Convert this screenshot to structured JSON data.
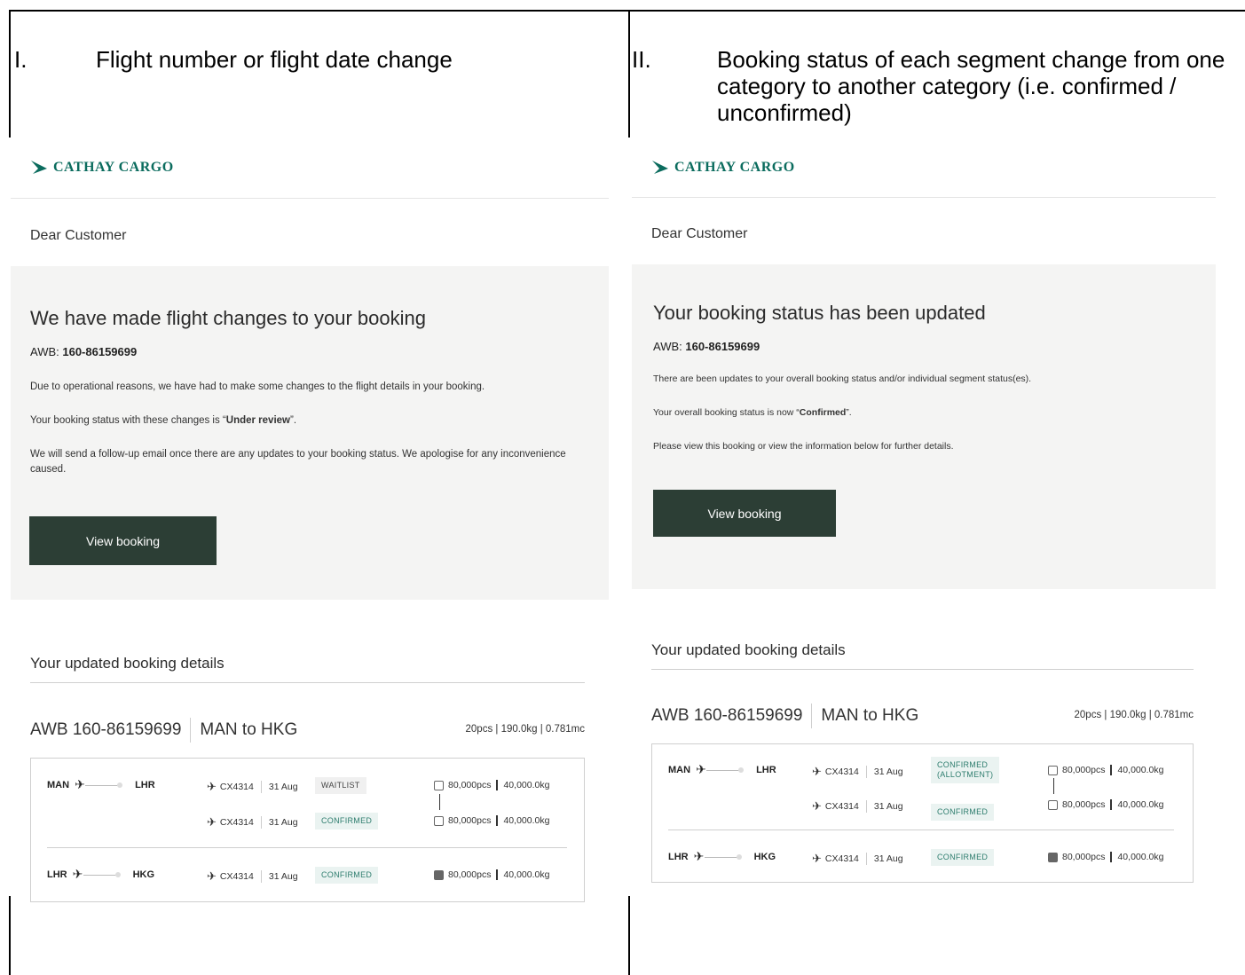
{
  "document": {
    "left_header": {
      "num": "I.",
      "text": "Flight number or flight date change"
    },
    "right_header": {
      "num": "II.",
      "text": "Booking status of each segment change from one category to another category (i.e. confirmed / unconfirmed)"
    }
  },
  "brand": {
    "name": "CATHAY CARGO",
    "color": "#0b6c5e"
  },
  "left_email": {
    "greeting": "Dear Customer",
    "title": "We have made flight changes to your booking",
    "awb_label": "AWB: ",
    "awb_value": "160-86159699",
    "p1": "Due to operational reasons, we have had to make some changes to the flight details in your booking.",
    "p2_pre": "Your booking status with these changes is “",
    "p2_bold": "Under review",
    "p2_post": "”.",
    "p3": "We will send a follow-up email once there are any updates to your booking status. We apologise for any inconvenience caused.",
    "button": "View booking",
    "section_title": "Your updated booking details",
    "awb_heading": "AWB 160-86159699",
    "route_heading": "MAN to HKG",
    "summary": "20pcs | 190.0kg | 0.781mc",
    "segments": [
      {
        "from": "MAN",
        "to": "LHR",
        "flights": [
          {
            "flight": "CX4314",
            "date": "31 Aug",
            "status": "WAITLIST",
            "pcs": "80,000pcs",
            "kg": "40,000.0kg"
          },
          {
            "flight": "CX4314",
            "date": "31 Aug",
            "status": "CONFIRMED",
            "pcs": "80,000pcs",
            "kg": "40,000.0kg"
          }
        ]
      },
      {
        "from": "LHR",
        "to": "HKG",
        "flights": [
          {
            "flight": "CX4314",
            "date": "31 Aug",
            "status": "CONFIRMED",
            "pcs": "80,000pcs",
            "kg": "40,000.0kg"
          }
        ]
      }
    ]
  },
  "right_email": {
    "greeting": "Dear Customer",
    "title": "Your booking status has been updated",
    "awb_label": "AWB: ",
    "awb_value": "160-86159699",
    "p1": "There are been updates to your overall booking status and/or individual segment status(es).",
    "p2_pre": "Your overall booking status is now “",
    "p2_bold": "Confirmed",
    "p2_post": "”.",
    "p3": "Please view this booking or view the information below for further details.",
    "button": "View booking",
    "section_title": "Your updated booking details",
    "awb_heading": "AWB 160-86159699",
    "route_heading": "MAN to HKG",
    "summary": "20pcs | 190.0kg | 0.781mc",
    "segments": [
      {
        "from": "MAN",
        "to": "LHR",
        "flights": [
          {
            "flight": "CX4314",
            "date": "31 Aug",
            "status_line1": "CONFIRMED",
            "status_line2": "(ALLOTMENT)",
            "pcs": "80,000pcs",
            "kg": "40,000.0kg"
          },
          {
            "flight": "CX4314",
            "date": "31 Aug",
            "status": "CONFIRMED",
            "pcs": "80,000pcs",
            "kg": "40,000.0kg"
          }
        ]
      },
      {
        "from": "LHR",
        "to": "HKG",
        "flights": [
          {
            "flight": "CX4314",
            "date": "31 Aug",
            "status": "CONFIRMED",
            "pcs": "80,000pcs",
            "kg": "40,000.0kg"
          }
        ]
      }
    ]
  }
}
